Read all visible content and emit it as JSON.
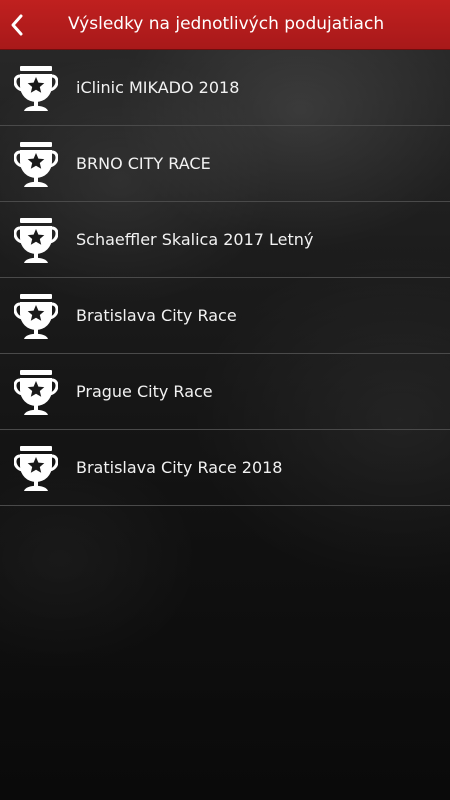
{
  "header": {
    "title": "Výsledky na jednotlivých podujatiach",
    "back_icon": "chevron-left-icon",
    "background_color": "#b51c1c"
  },
  "events": [
    {
      "label": "iClinic MIKADO 2018",
      "icon": "trophy-star-icon"
    },
    {
      "label": "BRNO CITY RACE",
      "icon": "trophy-star-icon"
    },
    {
      "label": "Schaeffler Skalica 2017 Letný",
      "icon": "trophy-star-icon"
    },
    {
      "label": "Bratislava City Race",
      "icon": "trophy-star-icon"
    },
    {
      "label": "Prague City Race",
      "icon": "trophy-star-icon"
    },
    {
      "label": "Bratislava City Race 2018",
      "icon": "trophy-star-icon"
    }
  ]
}
